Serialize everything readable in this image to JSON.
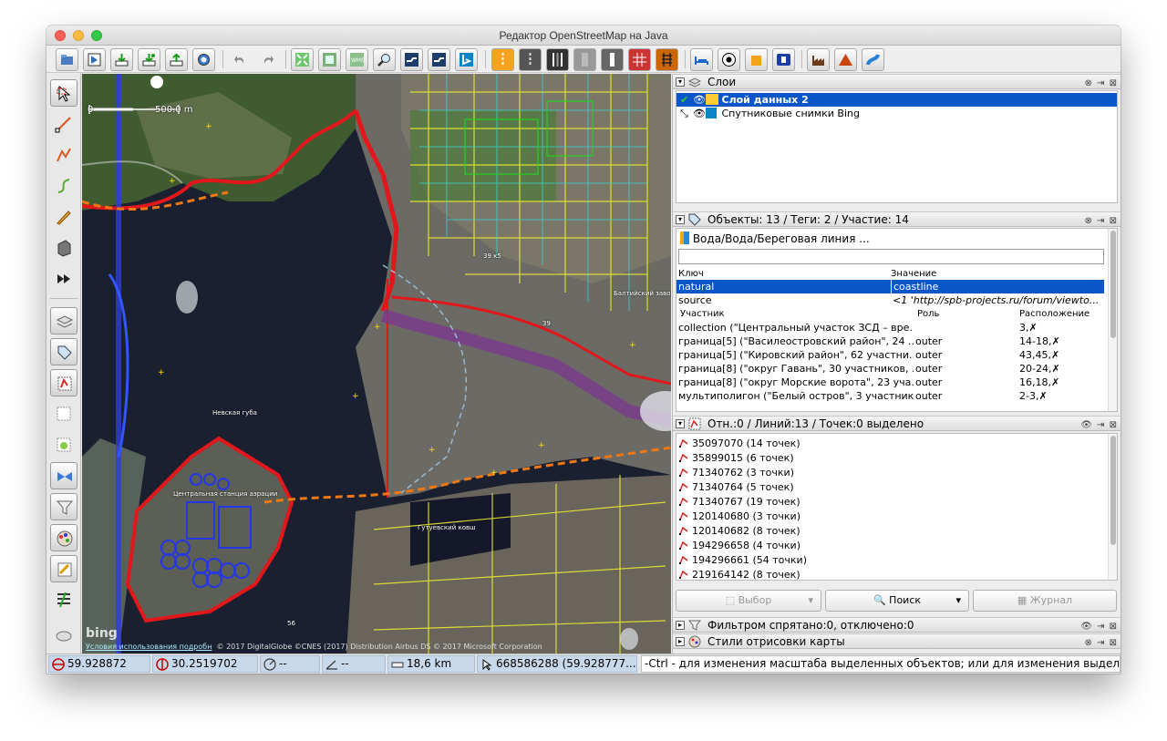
{
  "window": {
    "title": "Редактор OpenStreetMap на Java"
  },
  "toolbar": {
    "icons": [
      "open-file-icon",
      "save-icon",
      "download-icon",
      "download-along-icon",
      "upload-icon",
      "update-data-icon",
      "undo-icon",
      "redo-icon",
      "zoom-to-data-icon",
      "preferences-icon",
      "wms-icon",
      "search-icon",
      "mapnik-icon",
      "tms-icon",
      "bing-icon",
      "road-tag-icon",
      "rail-tag-icon",
      "tunnel-icon",
      "bridge-icon",
      "barrier-icon",
      "fence-icon",
      "wall-icon",
      "railway-icon",
      "hotel-icon",
      "football-icon",
      "shop-icon",
      "info-icon",
      "industrial-icon",
      "peak-icon",
      "waterway-icon"
    ]
  },
  "map": {
    "scale_zero": "0",
    "scale_label": "500.0 m",
    "labels": {
      "bay": "Невская губа",
      "aeration": "Центральная станция аэрации",
      "gutuevsky": "Гутуевский ковш",
      "baltic": "Балтийский завод",
      "building39": "39 к5",
      "building39b": "39",
      "building56": "56"
    },
    "attribution_link": "Условия использования подробн",
    "attribution_text": "© 2017 DigitalGlobe ©CNES (2017) Distribution Airbus DS © 2017 Microsoft Corporation",
    "bing_logo": "bing"
  },
  "layers_panel": {
    "title": "Слои",
    "items": [
      {
        "label": "Слой данных 2",
        "selected": true
      },
      {
        "label": "Спутниковые снимки Bing",
        "selected": false
      }
    ]
  },
  "objects_panel": {
    "title": "Объекты: 13 / Теги: 2 / Участие: 14",
    "preset": "Вода/Вода/Береговая линия ...",
    "col_key": "Ключ",
    "col_value": "Значение",
    "tags": [
      {
        "key": "natural",
        "value": "coastline"
      },
      {
        "key": "source",
        "value": "<1 'http://spb-projects.ru/forum/viewto..."
      }
    ],
    "mem_col_member": "Участник",
    "mem_col_role": "Роль",
    "mem_col_position": "Расположение",
    "memberships": [
      {
        "name": "collection (\"Центральный участок ЗСД – вре...",
        "role": "",
        "pos": "3,✗"
      },
      {
        "name": "граница[5] (\"Василеостровский район\", 24 ...",
        "role": "outer",
        "pos": "14-18,✗"
      },
      {
        "name": "граница[5] (\"Кировский район\", 62 участни...",
        "role": "outer",
        "pos": "43,45,✗"
      },
      {
        "name": "граница[8] (\"округ Гавань\", 30 участников, ...",
        "role": "outer",
        "pos": "20-24,✗"
      },
      {
        "name": "граница[8] (\"округ Морские ворота\", 23 уча...",
        "role": "outer",
        "pos": "16,18,✗"
      },
      {
        "name": "мультиполигон (\"Белый остров\", 3 участник...",
        "role": "outer",
        "pos": "2-3,✗"
      }
    ]
  },
  "selection_panel": {
    "title": "Отн.:0 / Линий:13 / Точек:0 выделено",
    "items": [
      "35097070 (14 точек)",
      "35899015 (6 точек)",
      "71340762 (3 точки)",
      "71340764 (5 точек)",
      "71340767 (19 точек)",
      "120140680 (3 точки)",
      "120140682 (8 точек)",
      "194296658 (4 точки)",
      "194296661 (54 точки)",
      "219164142 (8 точек)"
    ],
    "btn_select": "Выбор",
    "btn_search": "Поиск",
    "btn_history": "Журнал"
  },
  "filter_panel": {
    "title": "Фильтром спрятано:0, отключено:0"
  },
  "styles_panel": {
    "title": "Стили отрисовки карты"
  },
  "statusbar": {
    "lat": "59.928872",
    "lon": "30.2519702",
    "heading": "--",
    "angle": "--",
    "distance": "18,6 km",
    "object": "668586288 (59.928777...",
    "message": "-Ctrl - для изменения масштаба выделенных объектов; или для изменения выделения"
  }
}
